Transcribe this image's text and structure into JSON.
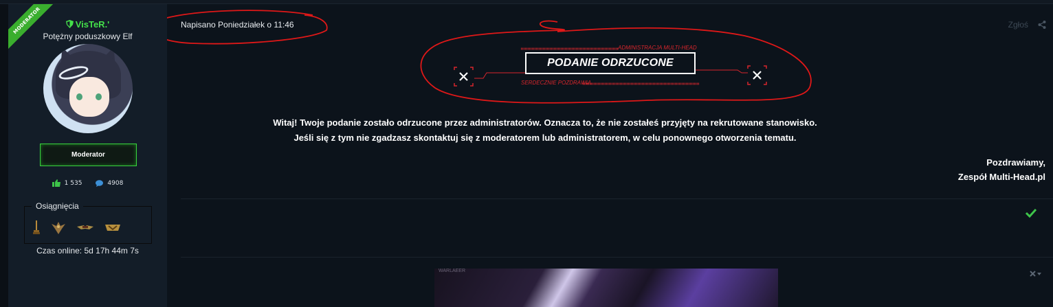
{
  "sidebar": {
    "ribbon": "MODERATOR",
    "username": "VisTeR.'",
    "user_title": "Potężny poduszkowy Elf",
    "role_badge": "Moderator",
    "likes": "1 535",
    "posts": "4908",
    "achievements_label": "Osiągnięcia",
    "achievements": [
      "trophy-icon",
      "eagle-icon",
      "wings-badge-icon",
      "rank-badge-icon"
    ],
    "online_time": "Czas online: 5d 17h 44m 7s"
  },
  "post": {
    "posted": "Napisano Poniedziałek o 11:46",
    "report": "Zgłoś",
    "banner": {
      "top": "ADMINISTRACJA MULTI-HEAD",
      "title": "PODANIE ODRZUCONE",
      "bottom": "SERDECZNIE POZDRAWIA"
    },
    "message_line1": "Witaj! Twoje podanie zostało odrzucone przez administratorów. Oznacza to, że nie zostałeś przyjęty na rekrutowane stanowisko.",
    "message_line2": "Jeśli się z tym nie zgadzasz skontaktuj się z moderatorem lub administratorem, w celu ponownego otworzenia tematu.",
    "signature_line1": "Pozdrawiamy,",
    "signature_line2": "Zespół Multi-Head.pl",
    "thumb_label": "WARLAEER"
  },
  "colors": {
    "accent_green": "#39d33e",
    "banner_red": "#d7262c",
    "annotation_red": "#e01818"
  }
}
